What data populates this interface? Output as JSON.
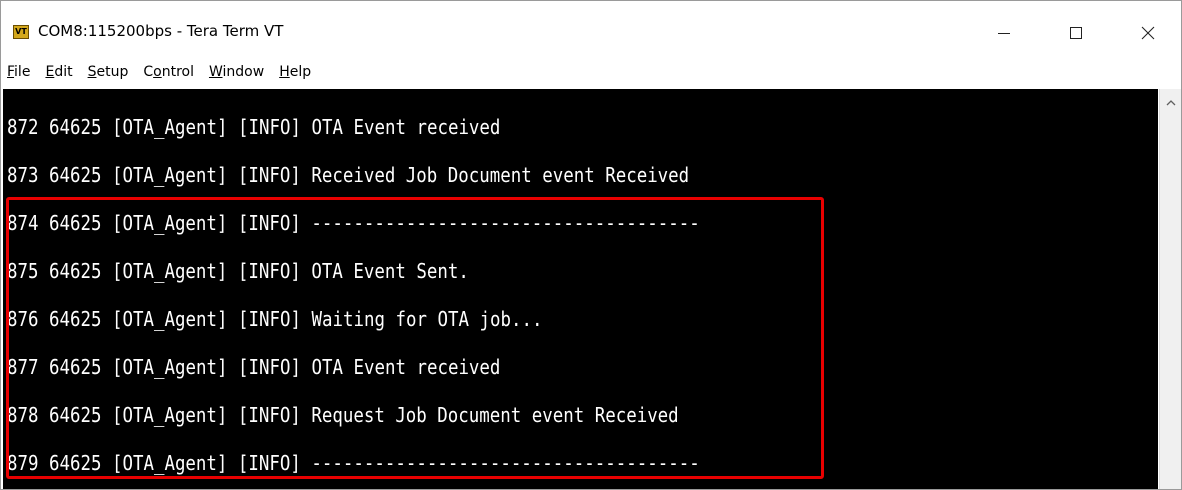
{
  "window": {
    "title": "COM8:115200bps - Tera Term VT",
    "icon": "tera-term-vt-icon",
    "icon_text": "VT",
    "controls": [
      "minimize-icon",
      "maximize-icon",
      "close-icon"
    ]
  },
  "menu": [
    {
      "accel": "F",
      "rest": "ile"
    },
    {
      "accel": "E",
      "rest": "dit"
    },
    {
      "accel": "S",
      "rest": "etup"
    },
    {
      "pre": "C",
      "accel": "o",
      "rest": "ntrol"
    },
    {
      "accel": "W",
      "rest": "indow"
    },
    {
      "accel": "H",
      "rest": "elp"
    }
  ],
  "terminal": {
    "lines": [
      "872 64625 [OTA_Agent] [INFO] OTA Event received",
      "873 64625 [OTA_Agent] [INFO] Received Job Document event Received",
      "874 64625 [OTA_Agent] [INFO] -------------------------------------",
      "875 64625 [OTA_Agent] [INFO] OTA Event Sent.",
      "876 64625 [OTA_Agent] [INFO] Waiting for OTA job...",
      "877 64625 [OTA_Agent] [INFO] OTA Event received",
      "878 64625 [OTA_Agent] [INFO] Request Job Document event Received",
      "879 64625 [OTA_Agent] [INFO] -------------------------------------"
    ],
    "background": "#000000",
    "foreground": "#ffffff"
  },
  "highlight": {
    "color": "#e80000"
  },
  "scrollbar": {
    "icon": "scroll-up-arrow-icon"
  }
}
